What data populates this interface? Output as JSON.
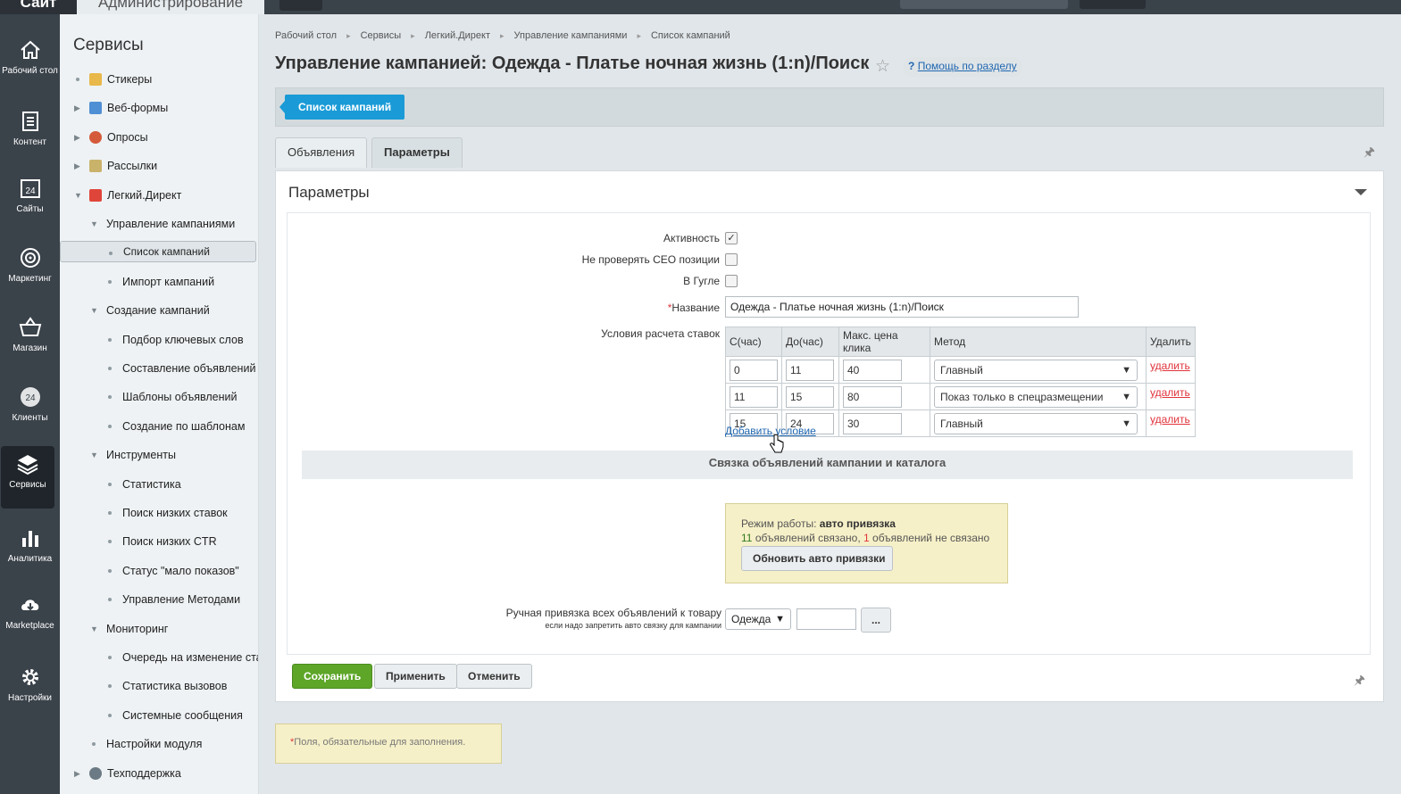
{
  "topbar": {
    "site": "Сайт",
    "admin": "Администрирование"
  },
  "iconbar": [
    {
      "label": "Рабочий стол",
      "icon": "home-icon"
    },
    {
      "label": "Контент",
      "icon": "document-icon"
    },
    {
      "label": "Сайты",
      "icon": "calendar-24-icon"
    },
    {
      "label": "Маркетинг",
      "icon": "target-icon"
    },
    {
      "label": "Магазин",
      "icon": "basket-icon"
    },
    {
      "label": "Клиенты",
      "icon": "clients-24-icon"
    },
    {
      "label": "Сервисы",
      "icon": "layers-icon"
    },
    {
      "label": "Аналитика",
      "icon": "bar-chart-icon"
    },
    {
      "label": "Marketplace",
      "icon": "cloud-download-icon"
    },
    {
      "label": "Настройки",
      "icon": "gear-icon"
    }
  ],
  "menu": {
    "title": "Сервисы",
    "items": [
      {
        "label": "Стикеры",
        "level": 0,
        "type": "dot",
        "icon": "stickers"
      },
      {
        "label": "Веб-формы",
        "level": 0,
        "type": "arrow",
        "icon": "forms"
      },
      {
        "label": "Опросы",
        "level": 0,
        "type": "arrow",
        "icon": "polls"
      },
      {
        "label": "Рассылки",
        "level": 0,
        "type": "arrow",
        "icon": "mail"
      },
      {
        "label": "Легкий.Директ",
        "level": 0,
        "type": "open",
        "icon": "direct"
      },
      {
        "label": "Управление кампаниями",
        "level": 1,
        "type": "open"
      },
      {
        "label": "Список кампаний",
        "level": 2,
        "type": "dot",
        "selected": true
      },
      {
        "label": "Импорт кампаний",
        "level": 2,
        "type": "dot"
      },
      {
        "label": "Создание кампаний",
        "level": 1,
        "type": "open"
      },
      {
        "label": "Подбор ключевых слов",
        "level": 2,
        "type": "dot"
      },
      {
        "label": "Составление объявлений",
        "level": 2,
        "type": "dot"
      },
      {
        "label": "Шаблоны объявлений",
        "level": 2,
        "type": "dot"
      },
      {
        "label": "Создание по шаблонам",
        "level": 2,
        "type": "dot"
      },
      {
        "label": "Инструменты",
        "level": 1,
        "type": "open"
      },
      {
        "label": "Статистика",
        "level": 2,
        "type": "dot"
      },
      {
        "label": "Поиск низких ставок",
        "level": 2,
        "type": "dot"
      },
      {
        "label": "Поиск низких CTR",
        "level": 2,
        "type": "dot"
      },
      {
        "label": "Статус \"мало показов\"",
        "level": 2,
        "type": "dot"
      },
      {
        "label": "Управление Методами",
        "level": 2,
        "type": "dot"
      },
      {
        "label": "Мониторинг",
        "level": 1,
        "type": "open"
      },
      {
        "label": "Очередь на изменение ставок",
        "level": 2,
        "type": "dot"
      },
      {
        "label": "Статистика вызовов",
        "level": 2,
        "type": "dot"
      },
      {
        "label": "Системные сообщения",
        "level": 2,
        "type": "dot"
      },
      {
        "label": "Настройки модуля",
        "level": 1,
        "type": "dot"
      },
      {
        "label": "Техподдержка",
        "level": 0,
        "type": "arrow",
        "icon": "support"
      }
    ]
  },
  "breadcrumbs": [
    "Рабочий стол",
    "Сервисы",
    "Легкий.Директ",
    "Управление кампаниями",
    "Список кампаний"
  ],
  "page_title": "Управление кампанией: Одежда - Платье ночная жизнь (1:n)/Поиск",
  "help_link": "Помощь по разделу",
  "toolbar": {
    "list_button": "Список кампаний"
  },
  "tabs": [
    {
      "label": "Объявления"
    },
    {
      "label": "Параметры",
      "active": true
    }
  ],
  "panel": {
    "title": "Параметры",
    "fields": {
      "active_label": "Активность",
      "active_checked": true,
      "seo_label": "Не проверять СЕО позиции",
      "seo_checked": false,
      "google_label": "В Гугле",
      "google_checked": false,
      "name_label": "Название",
      "name_required_mark": "*",
      "name_value": "Одежда - Платье ночная жизнь (1:n)/Поиск",
      "rates_label": "Условия расчета ставок"
    },
    "rates": {
      "headers": [
        "С(час)",
        "До(час)",
        "Макс. цена клика",
        "Метод",
        "Удалить"
      ],
      "rows": [
        {
          "from": "0",
          "to": "11",
          "max": "40",
          "method": "Главный",
          "delete": "удалить"
        },
        {
          "from": "11",
          "to": "15",
          "max": "80",
          "method": "Показ только в спецразмещении",
          "delete": "удалить"
        },
        {
          "from": "15",
          "to": "24",
          "max": "30",
          "method": "Главный",
          "delete": "удалить"
        }
      ],
      "add_condition": "Добавить условие"
    },
    "section_title": "Связка объявлений кампании и каталога",
    "notice": {
      "mode_prefix": "Режим работы:",
      "mode_value": "авто привязка",
      "linked_count": "11",
      "linked_text": "объявлений связано,",
      "unlinked_count": "1",
      "unlinked_text": "объявлений не связано",
      "refresh_button": "Обновить авто привязки"
    },
    "manual": {
      "label": "Ручная привязка всех объявлений к товару",
      "hint": "если надо запретить авто связку для кампании",
      "select_value": "Одежда",
      "input_value": "",
      "browse_button": "..."
    }
  },
  "actions": {
    "save": "Сохранить",
    "apply": "Применить",
    "cancel": "Отменить"
  },
  "required_note": {
    "star": "*",
    "text": "Поля, обязательные для заполнения."
  }
}
